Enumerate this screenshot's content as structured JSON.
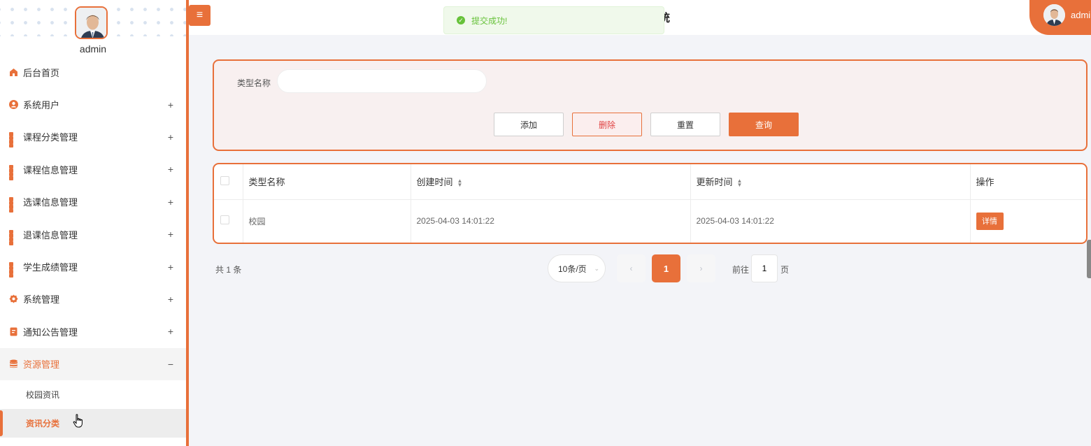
{
  "sidebar": {
    "username": "admin",
    "menu": [
      {
        "label": "后台首页",
        "icon": "home-icon"
      },
      {
        "label": "系统用户",
        "icon": "user-icon",
        "expand": "+"
      },
      {
        "label": "课程分类管理",
        "icon": "grid-icon",
        "expand": "+"
      },
      {
        "label": "课程信息管理",
        "icon": "grid-icon",
        "expand": "+"
      },
      {
        "label": "选课信息管理",
        "icon": "grid-icon",
        "expand": "+"
      },
      {
        "label": "退课信息管理",
        "icon": "grid-icon",
        "expand": "+"
      },
      {
        "label": "学生成绩管理",
        "icon": "grid-icon",
        "expand": "+"
      },
      {
        "label": "系统管理",
        "icon": "gear-icon",
        "expand": "+"
      },
      {
        "label": "通知公告管理",
        "icon": "notice-icon",
        "expand": "+"
      },
      {
        "label": "资源管理",
        "icon": "database-icon",
        "expand": "−"
      }
    ],
    "submenu": [
      {
        "label": "校园资讯"
      },
      {
        "label": "资讯分类"
      }
    ]
  },
  "header": {
    "menu_toggle": "≡",
    "title_fragment": "统",
    "user": "admin"
  },
  "toast": {
    "message": "提交成功!",
    "icon": "check-circle-icon"
  },
  "search": {
    "label": "类型名称",
    "value": "",
    "buttons": {
      "add": "添加",
      "delete": "删除",
      "reset": "重置",
      "query": "查询"
    }
  },
  "table": {
    "columns": [
      "类型名称",
      "创建时间",
      "更新时间",
      "操作"
    ],
    "rows": [
      {
        "name": "校园",
        "created": "2025-04-03 14:01:22",
        "updated": "2025-04-03 14:01:22",
        "action": "详情"
      }
    ]
  },
  "pagination": {
    "total": "共 1 条",
    "page_size": "10条/页",
    "current_page": "1",
    "goto_label": "前往",
    "goto_value": "1",
    "goto_suffix": "页",
    "prev": "‹",
    "next": "›"
  },
  "colors": {
    "accent": "#e8703a",
    "success": "#67c23a"
  }
}
